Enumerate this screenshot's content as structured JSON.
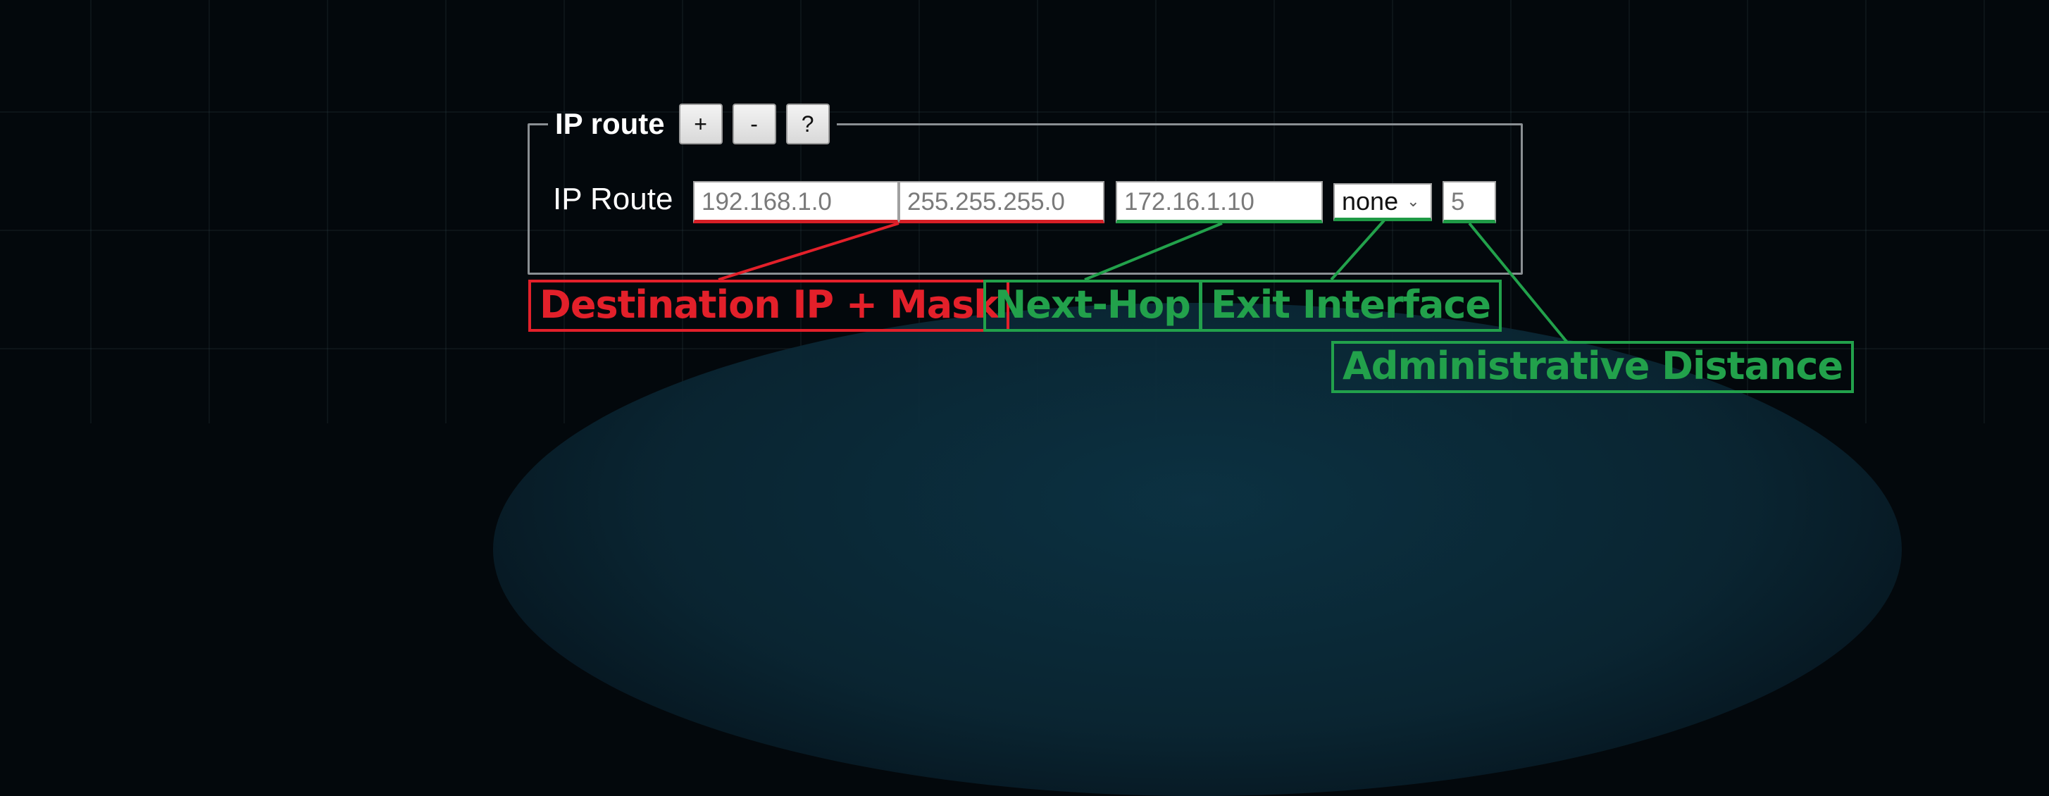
{
  "panel": {
    "legend_title": "IP route",
    "add_label": "+",
    "remove_label": "-",
    "help_label": "?",
    "row_label": "IP Route"
  },
  "fields": {
    "destination_ip": "192.168.1.0",
    "subnet_mask": "255.255.255.0",
    "next_hop": "172.16.1.10",
    "exit_interface": "none",
    "admin_distance": "5"
  },
  "callouts": {
    "destination": "Destination IP + Mask",
    "next_hop": "Next-Hop",
    "exit_interface": "Exit Interface",
    "admin_distance": "Administrative Distance"
  },
  "colors": {
    "destination": "#e3202a",
    "route_params": "#22a14b"
  }
}
